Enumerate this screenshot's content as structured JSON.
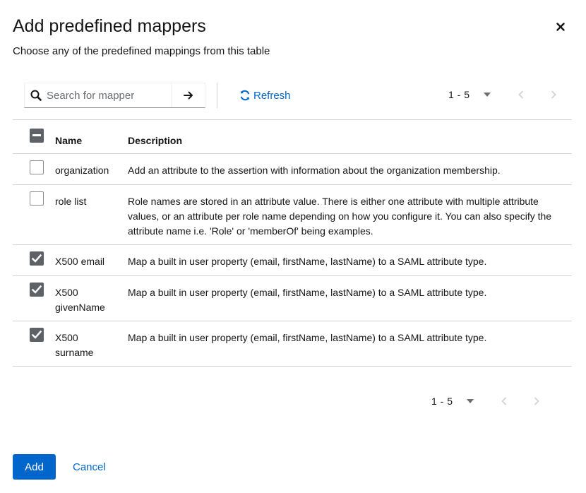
{
  "modal": {
    "title": "Add predefined mappers",
    "description": "Choose any of the predefined mappings from this table"
  },
  "toolbar": {
    "search_placeholder": "Search for mapper",
    "search_value": "",
    "refresh_label": "Refresh"
  },
  "pagination": {
    "top": {
      "range": "1 - 5"
    },
    "bottom": {
      "range": "1 - 5"
    }
  },
  "table": {
    "columns": {
      "name": "Name",
      "description": "Description"
    },
    "select_all_state": "partial",
    "rows": [
      {
        "name": "organization",
        "description": "Add an attribute to the assertion with information about the organization membership.",
        "checked": false
      },
      {
        "name": "role list",
        "description": "Role names are stored in an attribute value. There is either one attribute with multiple attribute values, or an attribute per role name depending on how you configure it. You can also specify the attribute name i.e. 'Role' or 'memberOf' being examples.",
        "checked": false
      },
      {
        "name": "X500 email",
        "description": "Map a built in user property (email, firstName, lastName) to a SAML attribute type.",
        "checked": true
      },
      {
        "name": "X500 givenName",
        "description": "Map a built in user property (email, firstName, lastName) to a SAML attribute type.",
        "checked": true
      },
      {
        "name": "X500 surname",
        "description": "Map a built in user property (email, firstName, lastName) to a SAML attribute type.",
        "checked": true
      }
    ]
  },
  "footer": {
    "add_label": "Add",
    "cancel_label": "Cancel"
  },
  "icons": {
    "close": "close-icon",
    "search": "search-icon",
    "arrow_right": "arrow-right-icon",
    "refresh": "sync-icon",
    "caret_down": "caret-down-icon",
    "prev": "angle-left-icon",
    "next": "angle-right-icon"
  },
  "colors": {
    "primary": "#0066cc",
    "checkbox_checked": "#5e6166",
    "border": "#d2d2d2",
    "text": "#151515",
    "disabled": "#d2d2d2"
  }
}
